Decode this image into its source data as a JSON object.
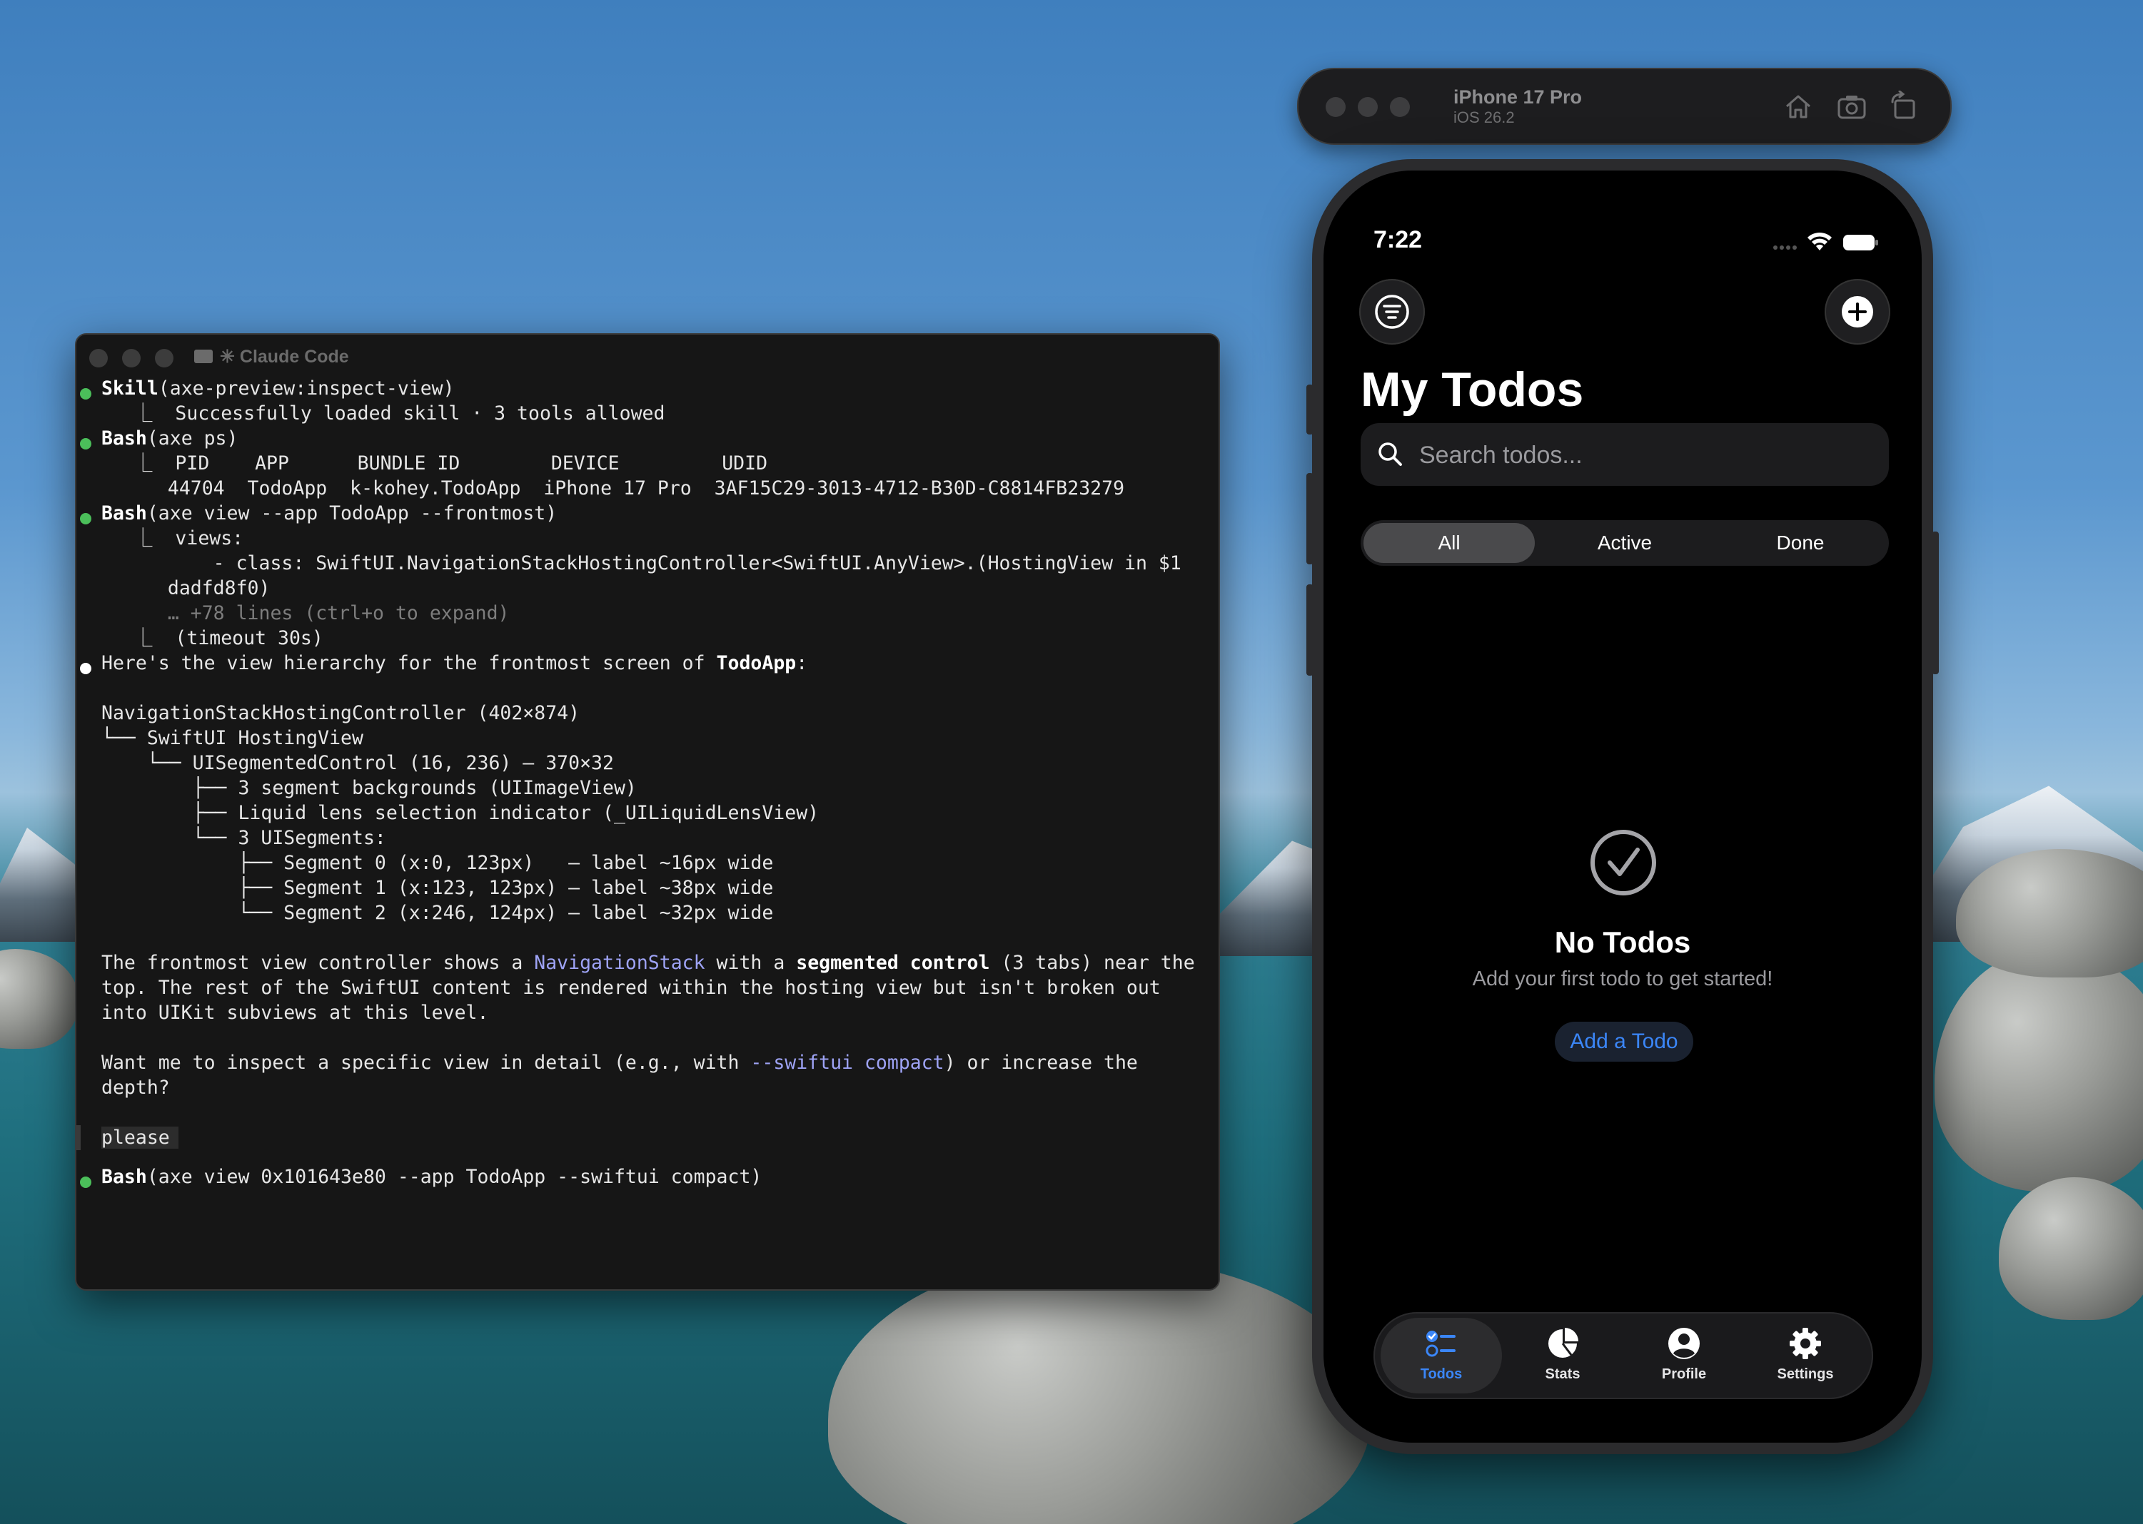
{
  "terminal": {
    "title": "✳ Claude Code",
    "lines": [
      {
        "bullet": "green",
        "head": "Skill",
        "rest": "(axe-preview:inspect-view)"
      },
      {
        "text": "⎿  Successfully loaded skill · 3 tools allowed"
      },
      {
        "bullet": "green",
        "head": "Bash",
        "rest": "(axe ps)"
      },
      {
        "text": "⎿  PID    APP      BUNDLE ID        DEVICE         UDID"
      },
      {
        "text": "   44704  TodoApp  k-kohey.TodoApp  iPhone 17 Pro  3AF15C29-3013-4712-B30D-C8814FB23279"
      },
      {
        "bullet": "green",
        "head": "Bash",
        "rest": "(axe view --app TodoApp --frontmost)"
      },
      {
        "text": "⎿  views:"
      },
      {
        "text": "       - class: SwiftUI.NavigationStackHostingController<SwiftUI.AnyView>.(HostingView in $1"
      },
      {
        "text": "   dadfd8f0)"
      },
      {
        "text": "   … +78 lines (ctrl+o to expand)"
      },
      {
        "text": "⎿  (timeout 30s)"
      },
      {
        "text": "Here's the view hierarchy for the frontmost screen of ",
        "bold_tail": "TodoApp",
        "tail": ":"
      },
      {
        "text": "NavigationStackHostingController (402×874)"
      },
      {
        "text": "└── SwiftUI HostingView"
      },
      {
        "text": "    └── UISegmentedControl (16, 236) — 370×32"
      },
      {
        "text": "        ├── 3 segment backgrounds (UIImageView)"
      },
      {
        "text": "        ├── Liquid lens selection indicator (_UILiquidLensView)"
      },
      {
        "text": "        └── 3 UISegments:"
      },
      {
        "text": "            ├── Segment 0 (x:0, 123px)   — label ~16px wide"
      },
      {
        "text": "            ├── Segment 1 (x:123, 123px) — label ~38px wide"
      },
      {
        "text": "            └── Segment 2 (x:246, 124px) — label ~32px wide"
      },
      {
        "p1": "The frontmost view controller shows a ",
        "link": "NavigationStack",
        "p2": " with a ",
        "bold": "segmented control",
        "p3": " (3 tabs) near the"
      },
      {
        "text": "top. The rest of the SwiftUI content is rendered within the hosting view but isn't broken out"
      },
      {
        "text": "into UIKit subviews at this level."
      },
      {
        "p1": "Want me to inspect a specific view in detail (e.g., with ",
        "link": "--swiftui compact",
        "p3": ") or increase the"
      },
      {
        "text": "depth?"
      },
      {
        "prompt": "please"
      },
      {
        "bullet": "green",
        "head": "Bash",
        "rest": "(axe view 0x101643e80 --app TodoApp --swiftui compact)"
      }
    ]
  },
  "simulator": {
    "device_name": "iPhone 17 Pro",
    "os_version": "iOS 26.2",
    "tool_icons": [
      "home-icon",
      "screenshot-icon",
      "rotate-icon"
    ]
  },
  "app": {
    "status_time": "7:22",
    "title": "My Todos",
    "search_placeholder": "Search todos...",
    "search_value": "",
    "segments": [
      "All",
      "Active",
      "Done"
    ],
    "selected_segment": "All",
    "empty_title": "No Todos",
    "empty_subtitle": "Add your first todo to get started!",
    "add_button": "Add a Todo",
    "tabs": [
      {
        "label": "Todos",
        "icon": "checklist-icon",
        "selected": true
      },
      {
        "label": "Stats",
        "icon": "pie-chart-icon",
        "selected": false
      },
      {
        "label": "Profile",
        "icon": "person-circle-icon",
        "selected": false
      },
      {
        "label": "Settings",
        "icon": "gear-icon",
        "selected": false
      }
    ],
    "accent_color": "#3b86f7"
  }
}
